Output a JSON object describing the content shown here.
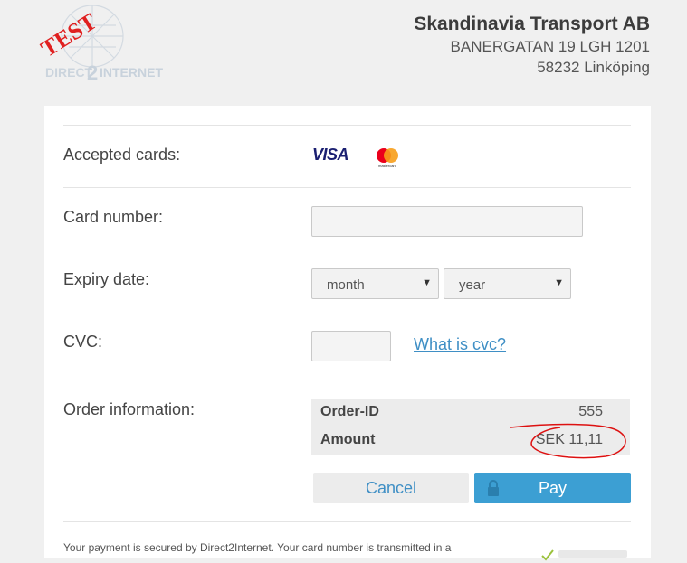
{
  "logo": {
    "test_stamp": "TEST",
    "brand": "DIRECT2INTERNET"
  },
  "merchant": {
    "name": "Skandinavia Transport AB",
    "address": "BANERGATAN 19 LGH 1201",
    "city": "58232 Linköping"
  },
  "form": {
    "accepted_cards_label": "Accepted cards:",
    "cards": [
      "VISA",
      "mastercard"
    ],
    "card_number_label": "Card number:",
    "card_number_value": "",
    "expiry_label": "Expiry date:",
    "month_select": "month",
    "year_select": "year",
    "cvc_label": "CVC:",
    "cvc_value": "",
    "cvc_help_link": "What is cvc?"
  },
  "order": {
    "label": "Order information:",
    "order_id_key": "Order-ID",
    "order_id_value": "555",
    "amount_key": "Amount",
    "amount_value": "SEK 11,11"
  },
  "buttons": {
    "cancel": "Cancel",
    "pay": "Pay"
  },
  "footer": {
    "security_text": "Your payment is secured by Direct2Internet. Your card number is transmitted in a"
  },
  "colors": {
    "accent": "#3c9fd3",
    "link": "#3f8fc5",
    "annotation": "#d11"
  }
}
